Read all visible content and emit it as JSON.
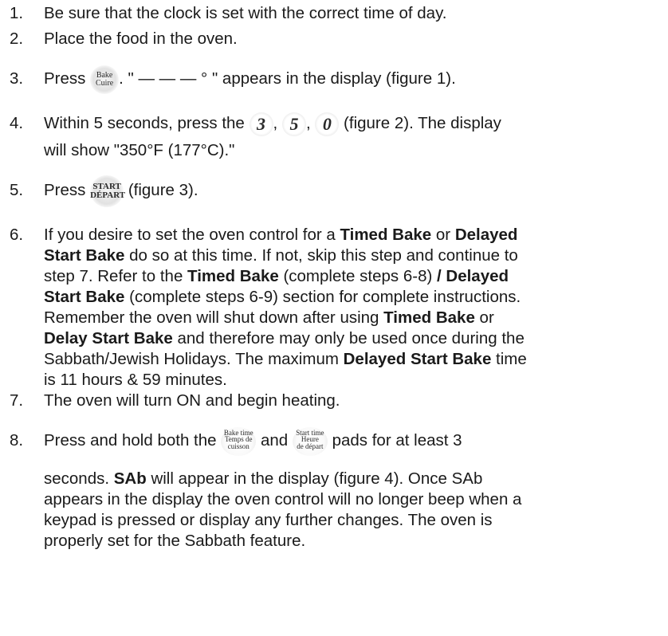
{
  "steps": {
    "s1": {
      "num": "1.",
      "text": "Be sure that the clock is set with the correct time of day."
    },
    "s2": {
      "num": "2.",
      "text": "Place the food in the oven."
    },
    "s3": {
      "num": "3.",
      "pre": "Press",
      "post": ". \" — — — ° \" appears in the display (figure 1).",
      "pad_line1": "Bake",
      "pad_line2": "Cuire"
    },
    "s4": {
      "num": "4.",
      "pre": "Within 5 seconds, press the",
      "key1": "3",
      "key2": "5",
      "key3": "0",
      "sep": ",",
      "post": "(figure 2). The display",
      "line2": "will show \"350°F (177°C).\""
    },
    "s5": {
      "num": "5.",
      "pre": "Press",
      "pad_line1": "START",
      "pad_line2": "DÉPART",
      "post": "(figure 3)."
    },
    "s6": {
      "num": "6.",
      "l1_a": "If you desire to set the oven control for a ",
      "l1_b": "Timed Bake",
      "l1_c": " or ",
      "l1_d": "Delayed",
      "l2_a": "Start Bake",
      "l2_b": " do so at this time. If not, skip this step and continue to",
      "l3_a": "step 7. Refer to the ",
      "l3_b": "Timed Bake",
      "l3_c": " (complete steps 6-8) ",
      "l3_d": "/ Delayed",
      "l4_a": "Start Bake",
      "l4_b": " (complete steps 6-9) section for complete instructions.",
      "l5_a": "Remember the oven will shut down after using ",
      "l5_b": "Timed Bake",
      "l5_c": " or",
      "l6_a": "Delay Start Bake",
      "l6_b": " and therefore may only be used once during the",
      "l7_a": "Sabbath/Jewish Holidays. The maximum ",
      "l7_b": "Delayed Start Bake",
      "l7_c": " time",
      "l8": "is 11 hours & 59 minutes."
    },
    "s7": {
      "num": "7.",
      "text": "The oven will turn ON and begin heating."
    },
    "s8": {
      "num": "8.",
      "pre": "Press and hold both the",
      "pad1_l1": "Bake time",
      "pad1_l2": "Temps de",
      "pad1_l3": "cuisson",
      "mid": "and",
      "pad2_l1": "Start time",
      "pad2_l2": "Heure",
      "pad2_l3": "de départ",
      "post": "pads for at least 3",
      "l2_a": "seconds. ",
      "l2_b": "SAb",
      "l2_c": " will appear in the display (figure 4). Once SAb",
      "l3": "appears in the display the oven control will no longer beep when a",
      "l4": "keypad is pressed or display any further changes. The oven is",
      "l5": "properly set for the Sabbath feature."
    }
  }
}
